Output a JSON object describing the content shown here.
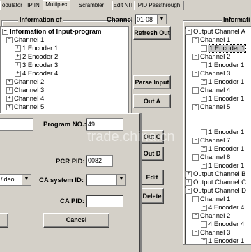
{
  "tabs": [
    "odulator",
    "IP IN",
    "Multiplex",
    "Scrambler",
    "Edit NIT",
    "PID Passthrough"
  ],
  "left_group_title": "Information of",
  "right_group_title": "Informati",
  "channel_label": "Channel",
  "channel_select_value": "01-08",
  "input_tree": {
    "root": "Information of Input-program",
    "items": [
      "Channel 1",
      "1 Encoder 1",
      "2 Encoder 2",
      "3 Encoder 3",
      "4 Encoder 4",
      "Channel 2",
      "Channel 3",
      "Channel 4",
      "Channel 5"
    ]
  },
  "output_tree": {
    "items": [
      "Output Channel A",
      "Channel 1",
      "1 Encoder 1",
      "Channel 2",
      "1 Encoder 1",
      "Channel 3",
      "1 Encoder 1",
      "Channel 4",
      "1 Encoder 1",
      "Channel 5",
      "1 Encoder 1",
      "Channel 7",
      "1 Encoder 1",
      "Channel 8",
      "1 Encoder 1",
      "Output Channel B",
      "Output Channel C",
      "Output Channel D",
      "Channel 1",
      "4 Encoder 4",
      "Channel 2",
      "4 Encoder 4",
      "Channel 3",
      "1 Encoder 1"
    ]
  },
  "buttons": {
    "refresh_out": "Refresh Out",
    "parse_input": "Parse Input",
    "out_a": "Out A",
    "out_c": "Out C",
    "out_d": "Out D",
    "edit": "Edit",
    "delete": "Delete",
    "cancel": "Cancel"
  },
  "dialog": {
    "program_no_label": "Program NO.:",
    "program_no_value": "49",
    "pcr_pid_label": "PCR PID: 0x",
    "pcr_pid_value": "0082",
    "type_value": "/ideo",
    "ca_system_label": "CA system ID:",
    "ca_system_value": "",
    "ca_pid_label": "CA PID:",
    "ca_pid_value": ""
  },
  "watermark": "trade.china.cn"
}
